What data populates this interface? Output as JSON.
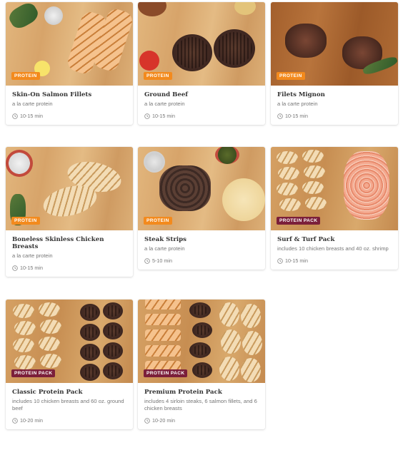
{
  "products": [
    {
      "title": "Skin-On Salmon Fillets",
      "subtitle": "a la carte protein",
      "time": "10-15 min",
      "badge": "PROTEIN",
      "badge_type": "protein"
    },
    {
      "title": "Ground Beef",
      "subtitle": "a la carte protein",
      "time": "10-15 min",
      "badge": "PROTEIN",
      "badge_type": "protein"
    },
    {
      "title": "Filets Mignon",
      "subtitle": "a la carte protein",
      "time": "10-15 min",
      "badge": "PROTEIN",
      "badge_type": "protein"
    },
    {
      "title": "Boneless Skinless Chicken Breasts",
      "subtitle": "a la carte protein",
      "time": "10-15 min",
      "badge": "PROTEIN",
      "badge_type": "protein"
    },
    {
      "title": "Steak Strips",
      "subtitle": "a la carte protein",
      "time": "5-10 min",
      "badge": "PROTEIN",
      "badge_type": "protein"
    },
    {
      "title": "Surf & Turf Pack",
      "subtitle": "includes 10 chicken breasts and 40 oz. shrimp",
      "time": "10-15 min",
      "badge": "PROTEIN PACK",
      "badge_type": "pack"
    },
    {
      "title": "Classic Protein Pack",
      "subtitle": "includes 10 chicken breasts and 60 oz. ground beef",
      "time": "10-20 min",
      "badge": "PROTEIN PACK",
      "badge_type": "pack"
    },
    {
      "title": "Premium Protein Pack",
      "subtitle": "includes 4 sirloin steaks, 6 salmon fillets, and 6 chicken breasts",
      "time": "10-20 min",
      "badge": "PROTEIN PACK",
      "badge_type": "pack"
    }
  ],
  "colors": {
    "protein_badge": "#f38a1d",
    "pack_badge": "#7b1f3a",
    "title": "#333333",
    "subtitle": "#777777"
  }
}
